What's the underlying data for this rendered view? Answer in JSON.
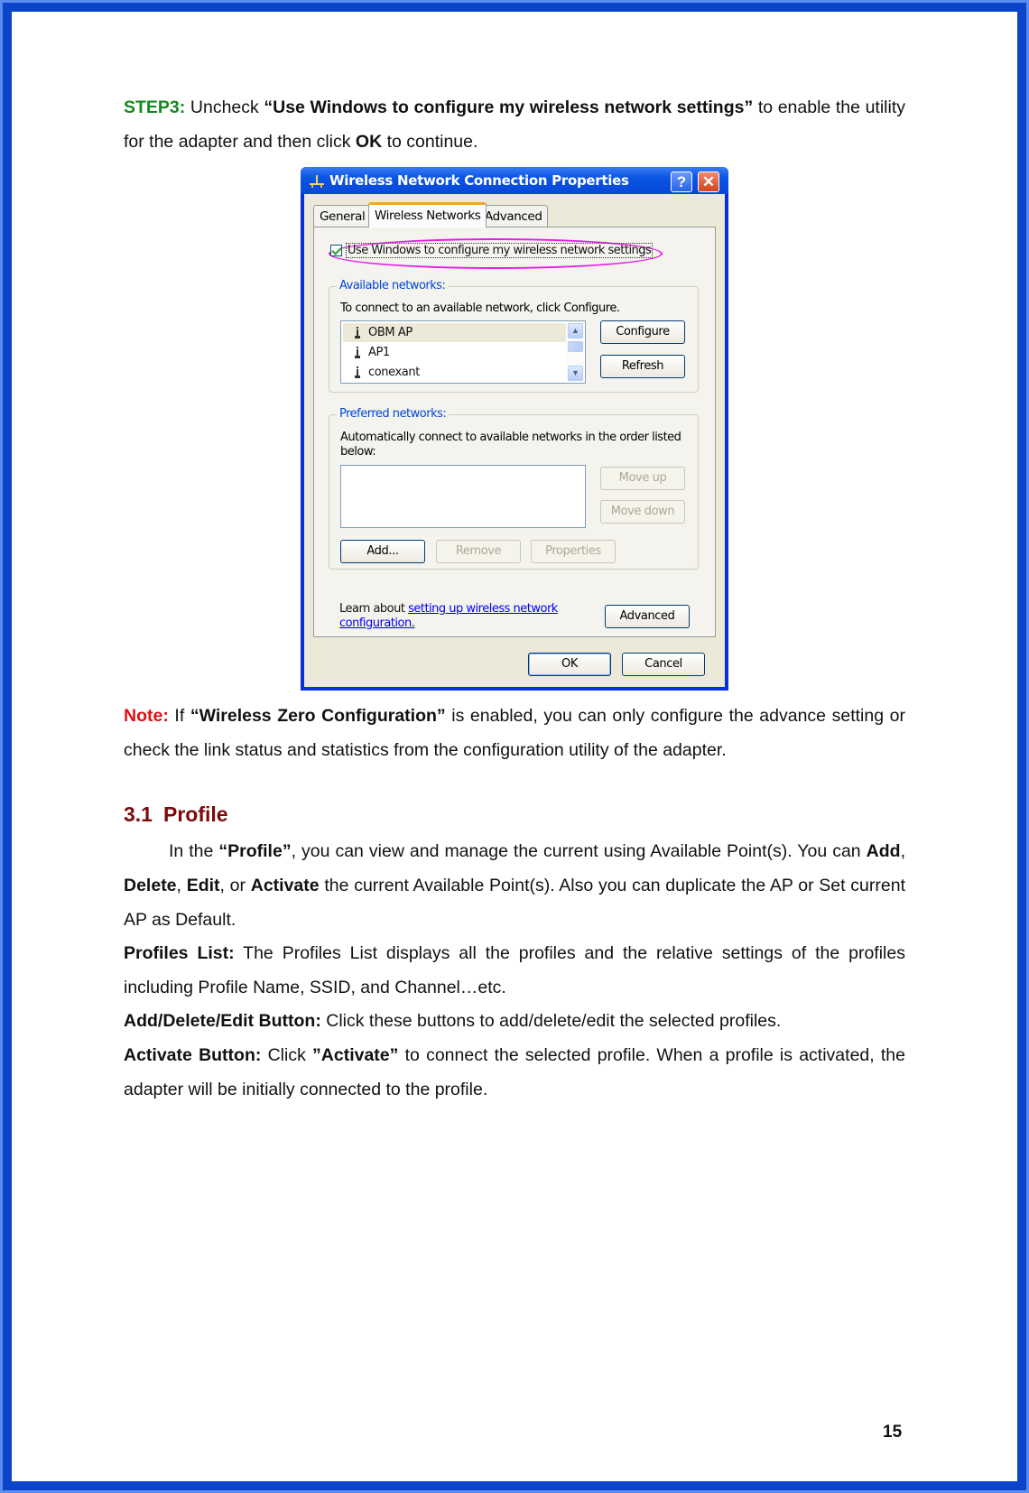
{
  "step3": {
    "label": "STEP3:",
    "pre": " Uncheck ",
    "option": "“Use Windows to configure my wireless network settings”",
    "mid": " to enable the utility for the adapter and then click ",
    "ok": "OK",
    "post": " to continue."
  },
  "dialog": {
    "title": "Wireless Network Connection Properties",
    "help": "?",
    "close": "✕",
    "tabs": [
      "General",
      "Wireless Networks",
      "Advanced"
    ],
    "use_windows_checkbox": {
      "label": "Use Windows to configure my wireless network settings",
      "checked": true
    },
    "available": {
      "legend": "Available networks:",
      "instructions": "To connect to an available network, click Configure.",
      "networks": [
        "OBM AP",
        "AP1",
        "conexant"
      ],
      "selected": "OBM AP",
      "configure": "Configure",
      "refresh": "Refresh"
    },
    "preferred": {
      "legend": "Preferred networks:",
      "instructions": "Automatically connect to available networks in the order listed below:",
      "move_up": "Move up",
      "move_down": "Move down",
      "add": "Add...",
      "remove": "Remove",
      "properties": "Properties"
    },
    "learn_prefix": "Learn about ",
    "learn_link": "setting up wireless network configuration.",
    "advanced": "Advanced",
    "ok": "OK",
    "cancel": "Cancel"
  },
  "note": {
    "label": "Note:",
    "pre": " If ",
    "wzc": "“Wireless Zero Configuration”",
    "post": " is enabled, you can only configure the advance setting or check the link status and statistics from the configuration utility of the adapter."
  },
  "section": {
    "number": "3.1",
    "title": "Profile",
    "intro_pre": "In the ",
    "intro_profile": "“Profile”",
    "intro_mid": ", you can view and manage the current using Available Point(s). You can ",
    "add": "Add",
    "comma1": ", ",
    "delete": "Delete",
    "comma2": ", ",
    "edit": "Edit",
    "or": ", or ",
    "activate": "Activate",
    "intro_post": " the current Available Point(s). Also you can duplicate the AP or Set current AP as Default.",
    "profiles_list_label": "Profiles List:",
    "profiles_list_text": " The Profiles List displays all the profiles and the relative settings of the profiles including Profile Name, SSID, and Channel…etc.",
    "ade_label": "Add/Delete/Edit Button:",
    "ade_text": " Click these buttons to add/delete/edit the selected profiles.",
    "activate_label": "Activate Button:",
    "activate_pre": " Click ",
    "activate_quote": "”Activate”",
    "activate_text": " to connect the selected profile. When a profile is activated, the adapter will be initially connected to the profile."
  },
  "page_number": "15"
}
